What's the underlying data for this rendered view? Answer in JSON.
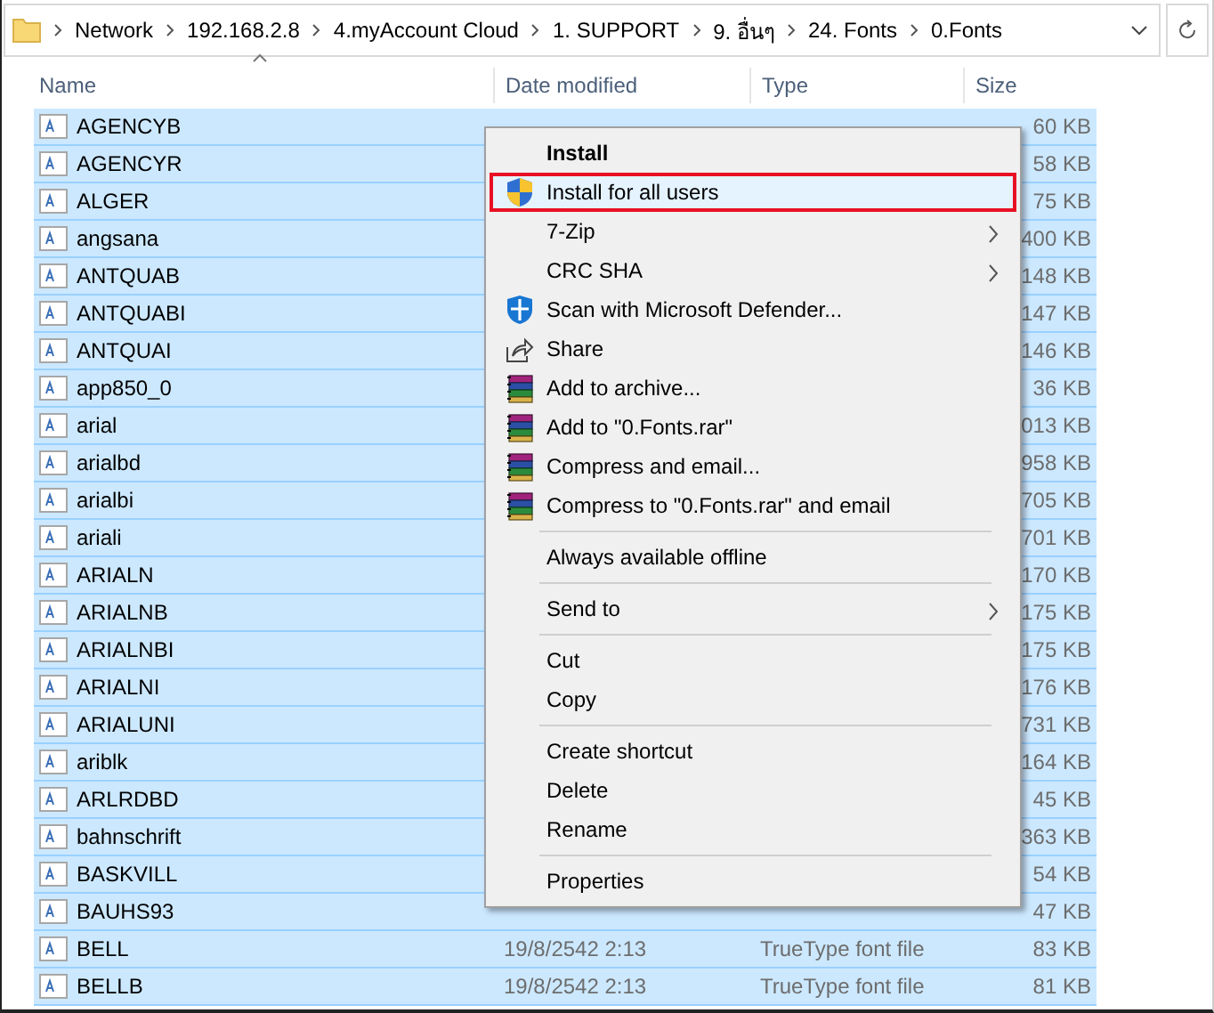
{
  "address_bar": {
    "path": [
      "Network",
      "192.168.2.8",
      "4.myAccount Cloud",
      "1. SUPPORT",
      "9. อื่นๆ",
      "24. Fonts",
      "0.Fonts"
    ]
  },
  "columns": [
    {
      "label": "Name"
    },
    {
      "label": "Date modified"
    },
    {
      "label": "Type"
    },
    {
      "label": "Size"
    }
  ],
  "files": [
    {
      "name": "AGENCYB",
      "size": "60 KB",
      "selected": true
    },
    {
      "name": "AGENCYR",
      "size": "58 KB",
      "selected": true
    },
    {
      "name": "ALGER",
      "size": "75 KB",
      "selected": true
    },
    {
      "name": "angsana",
      "size": "400 KB",
      "selected": true
    },
    {
      "name": "ANTQUAB",
      "size": "148 KB",
      "selected": true
    },
    {
      "name": "ANTQUABI",
      "size": "147 KB",
      "selected": true
    },
    {
      "name": "ANTQUAI",
      "size": "146 KB",
      "selected": true
    },
    {
      "name": "app850_0",
      "size": "36 KB",
      "selected": true
    },
    {
      "name": "arial",
      "size": "013 KB",
      "selected": true
    },
    {
      "name": "arialbd",
      "size": "958 KB",
      "selected": true
    },
    {
      "name": "arialbi",
      "size": "705 KB",
      "selected": true
    },
    {
      "name": "ariali",
      "size": "701 KB",
      "selected": true
    },
    {
      "name": "ARIALN",
      "size": "170 KB",
      "selected": true
    },
    {
      "name": "ARIALNB",
      "size": "175 KB",
      "selected": true
    },
    {
      "name": "ARIALNBI",
      "size": "175 KB",
      "selected": true
    },
    {
      "name": "ARIALNI",
      "size": "176 KB",
      "selected": true
    },
    {
      "name": "ARIALUNI",
      "size": "731 KB",
      "selected": true
    },
    {
      "name": "ariblk",
      "size": "164 KB",
      "selected": true
    },
    {
      "name": "ARLRDBD",
      "size": "45 KB",
      "selected": true
    },
    {
      "name": "bahnschrift",
      "size": "363 KB",
      "selected": true
    },
    {
      "name": "BASKVILL",
      "size": "54 KB",
      "selected": true
    },
    {
      "name": "BAUHS93",
      "size": "47 KB",
      "selected": true
    },
    {
      "name": "BELL",
      "date": "19/8/2542 2:13",
      "type": "TrueType font file",
      "size": "83 KB",
      "selected": true
    },
    {
      "name": "BELLB",
      "date": "19/8/2542 2:13",
      "type": "TrueType font file",
      "size": "81 KB",
      "selected": true
    }
  ],
  "context_menu": [
    {
      "kind": "plain",
      "label": "Install",
      "bold": true,
      "highlighted": false,
      "submenu": false
    },
    {
      "kind": "shield",
      "label": "Install for all users",
      "bold": false,
      "highlighted": true,
      "submenu": false
    },
    {
      "kind": "plain",
      "label": "7-Zip",
      "bold": false,
      "highlighted": false,
      "submenu": true
    },
    {
      "kind": "plain",
      "label": "CRC SHA",
      "bold": false,
      "highlighted": false,
      "submenu": true
    },
    {
      "kind": "defender",
      "label": "Scan with Microsoft Defender...",
      "bold": false,
      "highlighted": false,
      "submenu": false
    },
    {
      "kind": "share",
      "label": "Share",
      "bold": false,
      "highlighted": false,
      "submenu": false
    },
    {
      "kind": "archive",
      "label": "Add to archive...",
      "bold": false,
      "highlighted": false,
      "submenu": false
    },
    {
      "kind": "archive",
      "label": "Add to \"0.Fonts.rar\"",
      "bold": false,
      "highlighted": false,
      "submenu": false
    },
    {
      "kind": "archive",
      "label": "Compress and email...",
      "bold": false,
      "highlighted": false,
      "submenu": false
    },
    {
      "kind": "archive",
      "label": "Compress to \"0.Fonts.rar\" and email",
      "bold": false,
      "highlighted": false,
      "submenu": false
    },
    {
      "kind": "separator"
    },
    {
      "kind": "plain",
      "label": "Always available offline",
      "bold": false,
      "highlighted": false,
      "submenu": false
    },
    {
      "kind": "separator"
    },
    {
      "kind": "plain",
      "label": "Send to",
      "bold": false,
      "highlighted": false,
      "submenu": true
    },
    {
      "kind": "separator"
    },
    {
      "kind": "plain",
      "label": "Cut",
      "bold": false,
      "highlighted": false,
      "submenu": false
    },
    {
      "kind": "plain",
      "label": "Copy",
      "bold": false,
      "highlighted": false,
      "submenu": false
    },
    {
      "kind": "separator"
    },
    {
      "kind": "plain",
      "label": "Create shortcut",
      "bold": false,
      "highlighted": false,
      "submenu": false
    },
    {
      "kind": "plain",
      "label": "Delete",
      "bold": false,
      "highlighted": false,
      "submenu": false
    },
    {
      "kind": "plain",
      "label": "Rename",
      "bold": false,
      "highlighted": false,
      "submenu": false
    },
    {
      "kind": "separator"
    },
    {
      "kind": "plain",
      "label": "Properties",
      "bold": false,
      "highlighted": false,
      "submenu": false
    }
  ]
}
